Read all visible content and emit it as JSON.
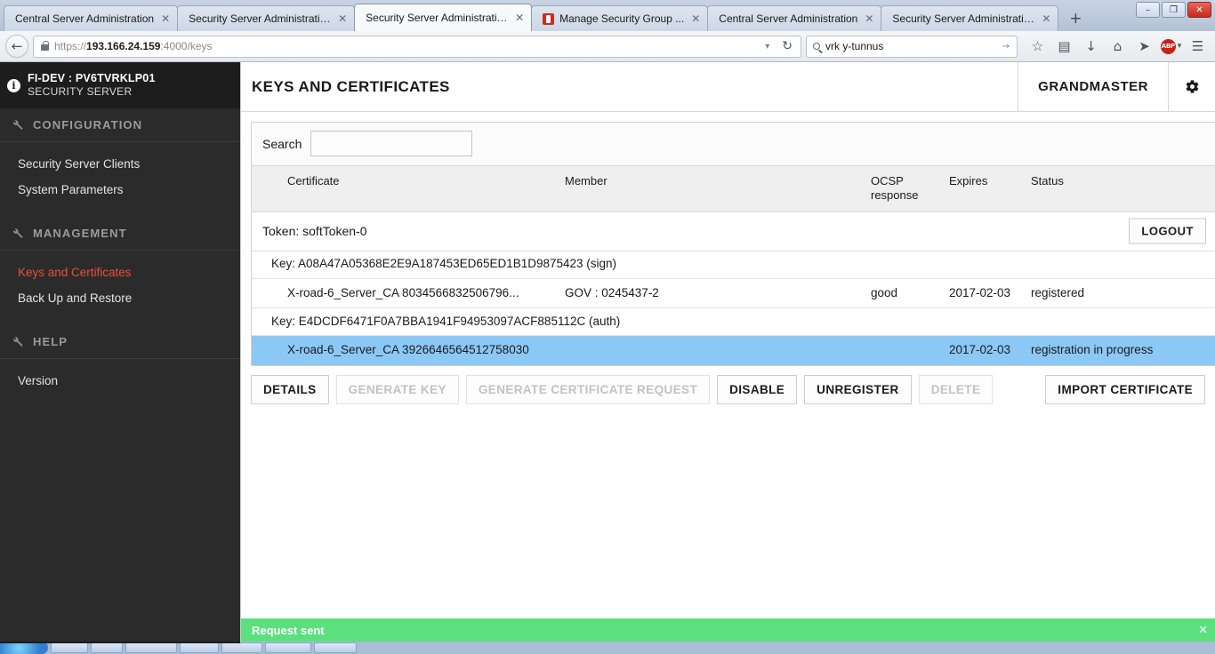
{
  "browser": {
    "tabs": [
      {
        "title": "Central Server Administration",
        "active": false,
        "favicon": false
      },
      {
        "title": "Security Server Administration",
        "active": false,
        "favicon": false
      },
      {
        "title": "Security Server Administration",
        "active": true,
        "favicon": false
      },
      {
        "title": "Manage Security Group ...",
        "active": false,
        "favicon": true
      },
      {
        "title": "Central Server Administration",
        "active": false,
        "favicon": false
      },
      {
        "title": "Security Server Administration",
        "active": false,
        "favicon": false
      }
    ],
    "tab_close_glyph": "✕",
    "new_tab_label": "+",
    "window_buttons": {
      "minimize": "–",
      "maximize": "❐",
      "close": "✕"
    },
    "back_glyph": "←",
    "url_prefix": "https://",
    "url_host": "193.166.24.159",
    "url_suffix": ":4000/keys",
    "url_dropdown_glyph": "▾",
    "reload_glyph": "↻",
    "search_value": "vrk y-tunnus",
    "search_go_glyph": "→",
    "toolbar_icons": [
      {
        "name": "bookmark-star-icon",
        "glyph": "☆"
      },
      {
        "name": "reader-list-icon",
        "glyph": "▤"
      },
      {
        "name": "downloads-icon",
        "glyph": "↓"
      },
      {
        "name": "home-icon",
        "glyph": "⌂"
      },
      {
        "name": "pocket-icon",
        "glyph": "➤"
      },
      {
        "name": "adblock-icon",
        "glyph": "ABP"
      },
      {
        "name": "menu-icon",
        "glyph": "☰"
      }
    ],
    "abp_dropdown_glyph": "▾"
  },
  "sidebar": {
    "server_id": "FI-DEV : PV6TVRKLP01",
    "server_role": "SECURITY SERVER",
    "info_glyph": "i",
    "sections": [
      {
        "label": "CONFIGURATION",
        "items": [
          {
            "label": "Security Server Clients",
            "active": false
          },
          {
            "label": "System Parameters",
            "active": false
          }
        ]
      },
      {
        "label": "MANAGEMENT",
        "items": [
          {
            "label": "Keys and Certificates",
            "active": true
          },
          {
            "label": "Back Up and Restore",
            "active": false
          }
        ]
      },
      {
        "label": "HELP",
        "items": [
          {
            "label": "Version",
            "active": false
          }
        ]
      }
    ]
  },
  "header": {
    "title": "KEYS AND CERTIFICATES",
    "user": "GRANDMASTER"
  },
  "search": {
    "label": "Search",
    "value": "",
    "placeholder": ""
  },
  "table": {
    "columns": {
      "certificate": "Certificate",
      "member": "Member",
      "ocsp_response": "OCSP response",
      "expires": "Expires",
      "status": "Status"
    },
    "token": {
      "label": "Token: softToken-0",
      "logout_label": "LOGOUT"
    },
    "rows": [
      {
        "type": "key",
        "label": "Key: A08A47A05368E2E9A187453ED65ED1B1D9875423 (sign)"
      },
      {
        "type": "certificate",
        "selected": false,
        "certificate": "X-road-6_Server_CA 8034566832506796...",
        "member": "GOV : 0245437-2",
        "ocsp_response": "good",
        "expires": "2017-02-03",
        "status": "registered"
      },
      {
        "type": "key",
        "label": "Key: E4DCDF6471F0A7BBA1941F94953097ACF885112C (auth)"
      },
      {
        "type": "certificate",
        "selected": true,
        "certificate": "X-road-6_Server_CA 3926646564512758030",
        "member": "",
        "ocsp_response": "",
        "expires": "2017-02-03",
        "status": "registration in progress"
      }
    ]
  },
  "buttons": [
    {
      "label": "DETAILS",
      "disabled": false
    },
    {
      "label": "GENERATE KEY",
      "disabled": true
    },
    {
      "label": "GENERATE CERTIFICATE REQUEST",
      "disabled": true
    },
    {
      "label": "DISABLE",
      "disabled": false
    },
    {
      "label": "UNREGISTER",
      "disabled": false
    },
    {
      "label": "DELETE",
      "disabled": true
    }
  ],
  "import_button": {
    "label": "IMPORT CERTIFICATE"
  },
  "status": {
    "message": "Request sent",
    "close_glyph": "✕",
    "color": "#5ce07e"
  }
}
